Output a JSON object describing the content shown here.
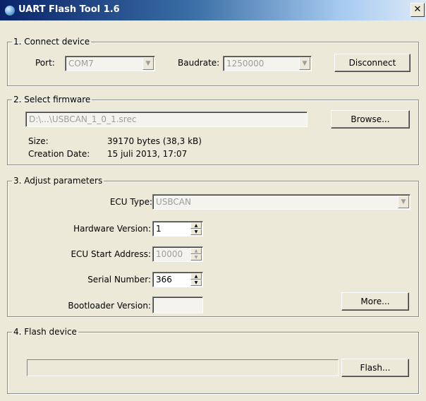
{
  "window": {
    "title": "UART Flash Tool 1.6",
    "close_glyph": "✕"
  },
  "connect": {
    "legend": "1. Connect device",
    "port_label": "Port:",
    "port_value": "COM7",
    "baud_label": "Baudrate:",
    "baud_value": "1250000",
    "disconnect_label": "Disconnect"
  },
  "firmware": {
    "legend": "2. Select firmware",
    "path": "D:\\...\\USBCAN_1_0_1.srec",
    "browse_label": "Browse...",
    "size_label": "Size:",
    "size_value": "39170 bytes (38,3 kB)",
    "date_label": "Creation Date:",
    "date_value": "15 juli 2013, 17:07"
  },
  "params": {
    "legend": "3. Adjust parameters",
    "ecu_type_label": "ECU Type:",
    "ecu_type_value": "USBCAN",
    "hw_label": "Hardware Version:",
    "hw_value": "1",
    "start_addr_label": "ECU Start Address:",
    "start_addr_value": "10000",
    "serial_label": "Serial Number:",
    "serial_value": "366",
    "bootloader_label": "Bootloader Version:",
    "bootloader_value": "",
    "more_label": "More..."
  },
  "flash": {
    "legend": "4. Flash device",
    "progress": 0,
    "flash_label": "Flash..."
  }
}
